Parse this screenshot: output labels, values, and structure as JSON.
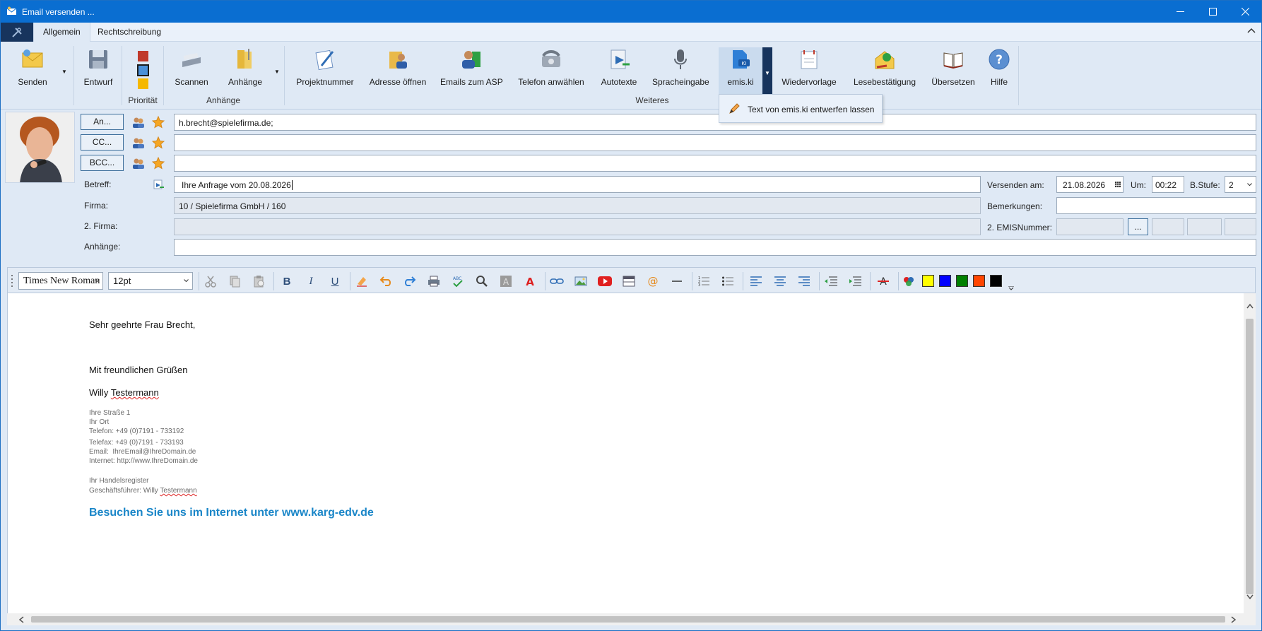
{
  "window": {
    "title": "Email versenden ..."
  },
  "menu": {
    "tabs": [
      "Allgemein",
      "Rechtschreibung"
    ]
  },
  "ribbon": {
    "send": "Senden",
    "draft": "Entwurf",
    "priority": "Priorität",
    "scan": "Scannen",
    "attachments": "Anhänge",
    "attachments_group": "Anhänge",
    "project_number": "Projektnummer",
    "open_address": "Adresse öffnen",
    "emails_to_asp": "Emails zum ASP",
    "dial_phone": "Telefon anwählen",
    "autotexts": "Autotexte",
    "voice_input": "Spracheingabe",
    "emis_ki": "emis.ki",
    "followup": "Wiedervorlage",
    "read_receipt": "Lesebestätigung",
    "translate": "Übersetzen",
    "help": "Hilfe",
    "more_group": "Weiteres"
  },
  "popup": {
    "item": "Text von emis.ki entwerfen lassen"
  },
  "fields": {
    "to_button": "An...",
    "cc_button": "CC...",
    "bcc_button": "BCC...",
    "to_value": "h.brecht@spielefirma.de;",
    "cc_value": "",
    "bcc_value": "",
    "subject_label": "Betreff:",
    "subject_value": "Ihre Anfrage vom 20.08.2026",
    "company_label": "Firma:",
    "company_value": "10 / Spielefirma GmbH / 160",
    "company2_label": "2. Firma:",
    "company2_value": "",
    "attachments_label": "Anhänge:",
    "attachments_value": "",
    "send_on_label": "Versenden am:",
    "send_on_value": "21.08.2026",
    "time_label": "Um:",
    "time_value": "00:22",
    "stage_label": "B.Stufe:",
    "stage_value": "2",
    "remarks_label": "Bemerkungen:",
    "remarks_value": "",
    "emis2_label": "2. EMISNummer:",
    "emis2_button": "..."
  },
  "editor_toolbar": {
    "font": "Times New Roman",
    "size": "12pt",
    "colors": [
      "#ffff00",
      "#0000ff",
      "#008000",
      "#ff4500",
      "#000000"
    ]
  },
  "body": {
    "greeting": "Sehr geehrte Frau Brecht,",
    "closing": "Mit freundlichen Grüßen",
    "name_first": "Willy ",
    "name_last": "Testermann",
    "sig_street": "Ihre Straße 1",
    "sig_city": "Ihr Ort",
    "sig_phone": "Telefon: +49 (0)7191 - 733192",
    "sig_fax": "Telefax: +49 (0)7191 - 733193",
    "sig_email": "Email:  IhreEmail@IhreDomain.de",
    "sig_web": "Internet: http://www.IhreDomain.de",
    "sig_register": "Ihr Handelsregister",
    "sig_ceo_prefix": "Geschäftsführer: Willy ",
    "sig_ceo_last": "Testermann",
    "promo": "Besuchen Sie uns im Internet unter www.karg-edv.de"
  }
}
